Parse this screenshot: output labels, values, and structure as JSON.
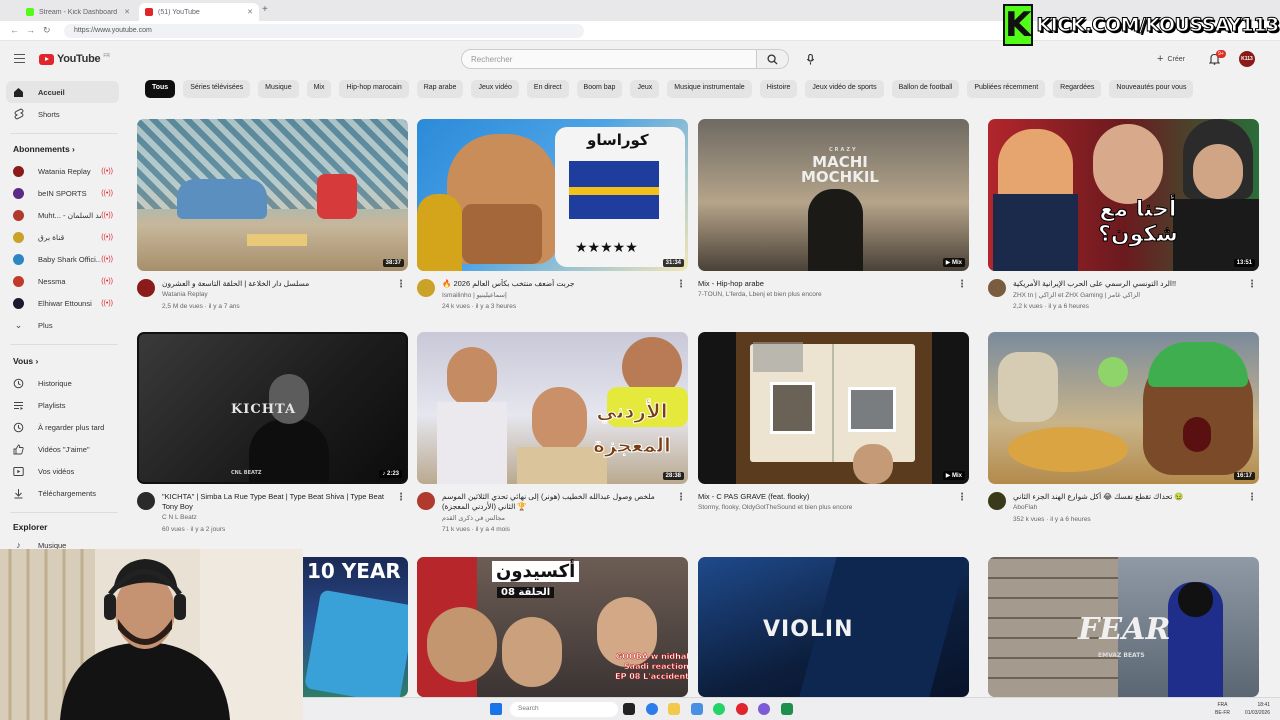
{
  "browser": {
    "tabs": [
      {
        "title": "Stream - Kick Dashboard",
        "favicon_color": "#53fc18"
      },
      {
        "title": "(51) YouTube",
        "favicon_color": "#e0252b"
      }
    ],
    "url": "https://www.youtube.com"
  },
  "overlay": {
    "kick_text": "KICK.COM/KOUSSAY113",
    "kick_letter": "K"
  },
  "header": {
    "logo_text": "YouTube",
    "region": "FR",
    "search_placeholder": "Rechercher",
    "create_label": "Créer",
    "notif_count": "9+",
    "avatar_text": "K113"
  },
  "sidebar": {
    "home": "Accueil",
    "shorts": "Shorts",
    "subs_header": "Abonnements",
    "subs": [
      {
        "name": "Watania Replay",
        "color": "#8b1a1a"
      },
      {
        "name": "beIN SPORTS",
        "color": "#5b2a86"
      },
      {
        "name": "Muht... - محمد السلمان",
        "color": "#b03a2e"
      },
      {
        "name": "قناة برق",
        "color": "#c9a227"
      },
      {
        "name": "Baby Shark Offici...",
        "color": "#2e86c1"
      },
      {
        "name": "Nessma",
        "color": "#c0392b"
      },
      {
        "name": "Elhiwar Ettounsi",
        "color": "#1a1a2e"
      }
    ],
    "more": "Plus",
    "you_header": "Vous",
    "you_items": [
      "Historique",
      "Playlists",
      "À regarder plus tard",
      "Vidéos \"J'aime\"",
      "Vos vidéos",
      "Téléchargements"
    ],
    "explore_header": "Explorer",
    "explore_items": [
      "Musique"
    ]
  },
  "chips": [
    "Tous",
    "Séries télévisées",
    "Musique",
    "Mix",
    "Hip-hop marocain",
    "Rap arabe",
    "Jeux vidéo",
    "En direct",
    "Boom bap",
    "Jeux",
    "Musique instrumentale",
    "Histoire",
    "Jeux vidéo de sports",
    "Ballon de football",
    "Publiées récemment",
    "Regardées",
    "Nouveautés pour vous"
  ],
  "videos": [
    {
      "title": "مسلسل دار الخلاعة | الحلقة التاسعة و العشرون",
      "channel": "Watania Replay",
      "stats": "2,5 M de vues · il y a 7 ans",
      "duration": "38:37"
    },
    {
      "title": "🔥 جربت أضعف منتخب بكأس العالم 2026",
      "channel": "Ismailinho | إسماعيلينيو",
      "stats": "24 k vues · il y a 3 heures",
      "duration": "31:34",
      "thumb_text": "كوراساو"
    },
    {
      "title": "Mix - Hip-hop arabe",
      "channel": "7-TOUN, L'ferda, Lbenj et bien plus encore",
      "stats": "",
      "duration": "Mix",
      "thumb_text": "MACHI MOCHKIL",
      "thumb_small": "CRAZY"
    },
    {
      "title": "الرد التونسي الرسمي على الحرب الإيرانية الأمريكية!!",
      "channel": "ZHX tn | الزاكي et ZHX Gaming | الزاكي غامر",
      "stats": "2,2 k vues · il y a 6 heures",
      "duration": "13:51",
      "thumb_text": "أحنا مع شكون؟"
    },
    {
      "title": "\"KICHTA\" | Simba La Rue Type Beat | Type Beat Shiva | Type Beat Tony Boy",
      "channel": "C N L Beatz",
      "stats": "60 vues · il y a 2 jours",
      "duration": "2:23",
      "thumb_text": "KICHTA",
      "thumb_small": "CNL BEATZ"
    },
    {
      "title": "ملخص وصول عبدالله الخطيب (هونر) إلى نهائي تحدي الثلاثين الموسم الثاني (الأردني المعجزة) 🏆",
      "channel": "مجالس في ذكرى القدم",
      "stats": "71 k vues · il y a 4 mois",
      "duration": "28:38",
      "thumb_text": "الأردني المعجزة"
    },
    {
      "title": "Mix - C PAS GRAVE (feat. flooky)",
      "channel": "Stormy, flooky, OldyGotTheSound et bien plus encore",
      "stats": "",
      "duration": "Mix"
    },
    {
      "title": "تحداك تقطع نفسك 😂 أكل شوارع الهند الجزء الثاني 🤢",
      "channel": "AboFlah",
      "stats": "352 k vues · il y a 6 heures",
      "duration": "16:17"
    },
    {
      "title": "",
      "channel": "",
      "stats": "",
      "duration": "",
      "thumb_text": "10 YEAR"
    },
    {
      "title": "",
      "channel": "",
      "stats": "",
      "duration": "",
      "thumb_text": "أكسيدون",
      "thumb_small": "الحلقة 08",
      "thumb_caption": "GOOBA w nidhal Saadi reaction EP 08 L'accident"
    },
    {
      "title": "",
      "channel": "",
      "stats": "",
      "duration": "",
      "thumb_text": "VIOLIN"
    },
    {
      "title": "",
      "channel": "",
      "stats": "",
      "duration": "",
      "thumb_text": "FEAR",
      "thumb_small": "EMVAZ BEATS"
    }
  ],
  "taskbar": {
    "search": "Search",
    "lang": "FRA\nBE-FR",
    "time": "18:41",
    "date": "01/03/2026"
  }
}
